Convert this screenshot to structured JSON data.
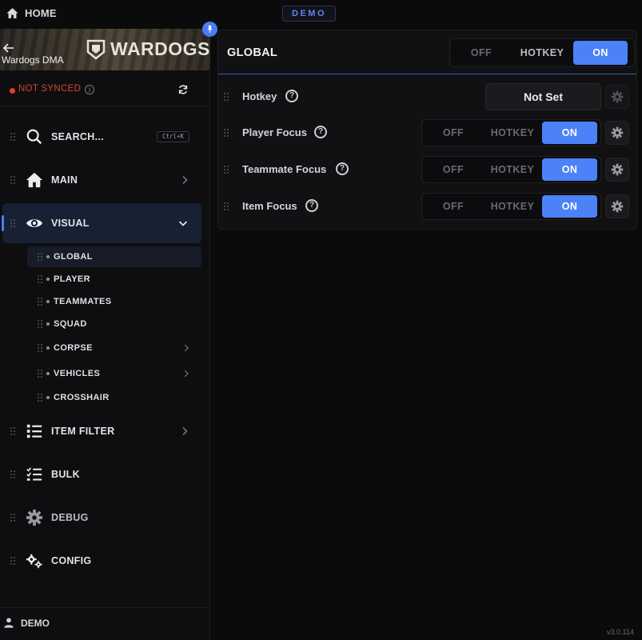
{
  "topbar": {
    "home_label": "HOME",
    "demo_badge": "DEMO"
  },
  "sidebar": {
    "banner": {
      "brand_name": "Wardogs DMA",
      "logo_text": "WARDOGS"
    },
    "sync_status": "NOT SYNCED",
    "search": {
      "label": "SEARCH...",
      "shortcut": "Ctrl+K"
    },
    "nav": [
      {
        "label": "MAIN",
        "icon": "home-icon"
      },
      {
        "label": "VISUAL",
        "icon": "eye-icon",
        "expanded": true
      },
      {
        "label": "ITEM FILTER",
        "icon": "list-icon"
      },
      {
        "label": "BULK",
        "icon": "checklist-icon"
      },
      {
        "label": "DEBUG",
        "icon": "gear-icon"
      },
      {
        "label": "CONFIG",
        "icon": "gears-icon"
      }
    ],
    "visual_sub": [
      {
        "label": "GLOBAL",
        "active": true
      },
      {
        "label": "PLAYER"
      },
      {
        "label": "TEAMMATES"
      },
      {
        "label": "SQUAD"
      },
      {
        "label": "CORPSE",
        "has_children": true
      },
      {
        "label": "VEHICLES",
        "has_children": true
      },
      {
        "label": "CROSSHAIR"
      }
    ],
    "user": "DEMO"
  },
  "panel": {
    "title": "GLOBAL",
    "mode": {
      "options": [
        "OFF",
        "HOTKEY",
        "ON"
      ],
      "selected": "ON"
    },
    "rows": [
      {
        "label": "Hotkey",
        "value": "Not Set"
      },
      {
        "label": "Player Focus",
        "options": [
          "OFF",
          "HOTKEY",
          "ON"
        ],
        "selected": "ON"
      },
      {
        "label": "Teammate Focus",
        "options": [
          "OFF",
          "HOTKEY",
          "ON"
        ],
        "selected": "ON"
      },
      {
        "label": "Item Focus",
        "options": [
          "OFF",
          "HOTKEY",
          "ON"
        ],
        "selected": "ON"
      }
    ]
  },
  "version": "v3.0.114",
  "colors": {
    "accent": "#4b82f7",
    "status_error": "#e03c2e",
    "sub_dot": "#63b064",
    "background": "#0b0b0c"
  }
}
